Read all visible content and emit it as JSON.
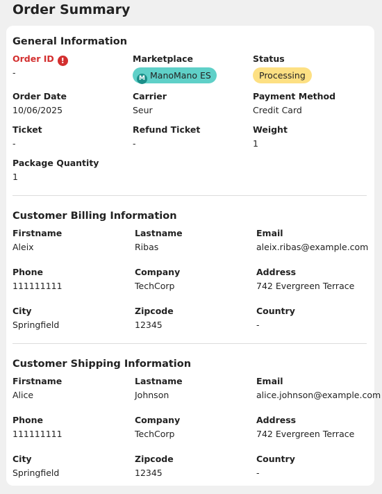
{
  "page": {
    "title": "Order Summary"
  },
  "general": {
    "title": "General Information",
    "order_id": {
      "label": "Order ID",
      "value": "-",
      "error_icon": "exclamation-circle-icon"
    },
    "marketplace": {
      "label": "Marketplace",
      "value": "ManoMano ES",
      "icon": "manomano-logo-icon"
    },
    "status": {
      "label": "Status",
      "value": "Processing"
    },
    "order_date": {
      "label": "Order Date",
      "value": "10/06/2025"
    },
    "carrier": {
      "label": "Carrier",
      "value": "Seur"
    },
    "payment_method": {
      "label": "Payment Method",
      "value": "Credit Card"
    },
    "ticket": {
      "label": "Ticket",
      "value": "-"
    },
    "refund_ticket": {
      "label": "Refund Ticket",
      "value": "-"
    },
    "weight": {
      "label": "Weight",
      "value": "1"
    },
    "package_quantity": {
      "label": "Package Quantity",
      "value": "1"
    }
  },
  "billing": {
    "title": "Customer Billing Information",
    "firstname": {
      "label": "Firstname",
      "value": "Aleix"
    },
    "lastname": {
      "label": "Lastname",
      "value": "Ribas"
    },
    "email": {
      "label": "Email",
      "value": "aleix.ribas@example.com"
    },
    "phone": {
      "label": "Phone",
      "value": "111111111"
    },
    "company": {
      "label": "Company",
      "value": "TechCorp"
    },
    "address": {
      "label": "Address",
      "value": "742 Evergreen Terrace"
    },
    "city": {
      "label": "City",
      "value": "Springfield"
    },
    "zipcode": {
      "label": "Zipcode",
      "value": "12345"
    },
    "country": {
      "label": "Country",
      "value": "-"
    }
  },
  "shipping": {
    "title": "Customer Shipping Information",
    "firstname": {
      "label": "Firstname",
      "value": "Alice"
    },
    "lastname": {
      "label": "Lastname",
      "value": "Johnson"
    },
    "email": {
      "label": "Email",
      "value": "alice.johnson@example.com"
    },
    "phone": {
      "label": "Phone",
      "value": "111111111"
    },
    "company": {
      "label": "Company",
      "value": "TechCorp"
    },
    "address": {
      "label": "Address",
      "value": "742 Evergreen Terrace"
    },
    "city": {
      "label": "City",
      "value": "Springfield"
    },
    "zipcode": {
      "label": "Zipcode",
      "value": "12345"
    },
    "country": {
      "label": "Country",
      "value": "-"
    }
  },
  "colors": {
    "error": "#d32f2f",
    "marketplace_chip": "#5fd0c8",
    "status_chip": "#fde083",
    "background": "#f0f0f0"
  }
}
